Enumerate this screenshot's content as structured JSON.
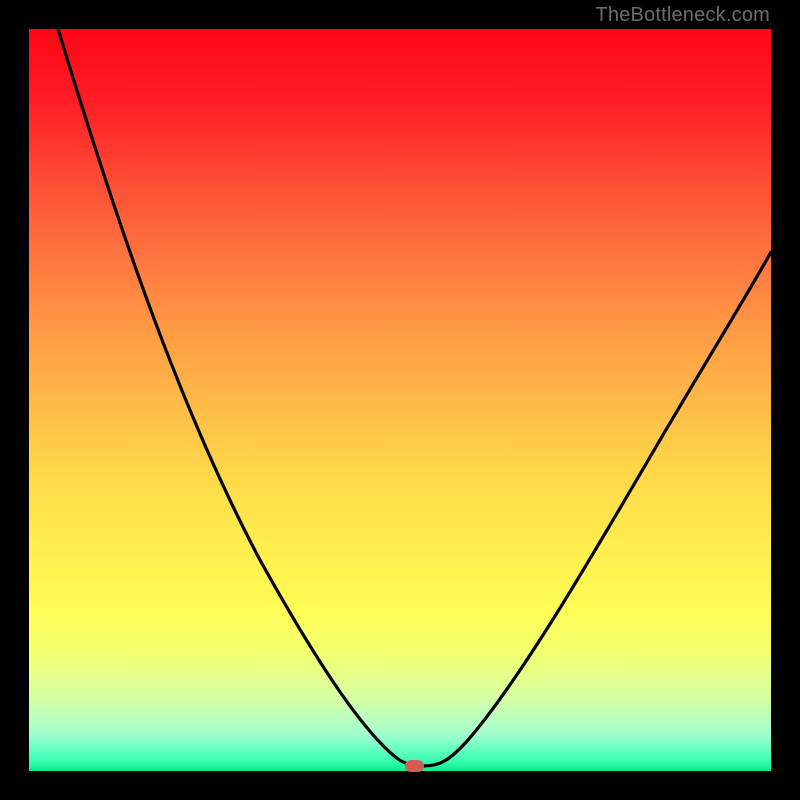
{
  "watermark": "TheBottleneck.com",
  "chart_data": {
    "type": "line",
    "title": "",
    "xlabel": "",
    "ylabel": "",
    "xlim": [
      0,
      100
    ],
    "ylim": [
      0,
      100
    ],
    "grid": false,
    "series": [
      {
        "name": "left-curve",
        "x": [
          4,
          8,
          12,
          16,
          20,
          24,
          28,
          32,
          36,
          40,
          44,
          47,
          49,
          50,
          51,
          53
        ],
        "y": [
          100,
          92,
          84,
          76,
          68,
          60,
          52,
          44,
          36,
          28,
          20,
          12,
          6,
          2,
          0.5,
          0.4
        ]
      },
      {
        "name": "right-curve",
        "x": [
          53,
          55,
          58,
          62,
          66,
          70,
          74,
          78,
          82,
          86,
          90,
          94,
          98,
          100
        ],
        "y": [
          0.4,
          2,
          6,
          12,
          19,
          26,
          33,
          40,
          47,
          53,
          59,
          64,
          68,
          70
        ]
      }
    ],
    "marker": {
      "x": 51.5,
      "y": 0.3,
      "color": "#d95a54"
    },
    "background_gradient": {
      "top": "#ff0615",
      "bottom": "#05ee8b",
      "direction": "vertical"
    }
  }
}
